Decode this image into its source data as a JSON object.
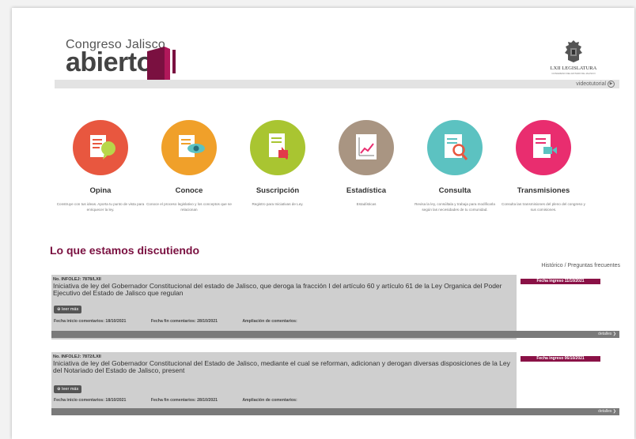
{
  "header": {
    "logo_top": "Congreso Jalisco",
    "logo_main": "abierto",
    "legislature_title": "LXII LEGISLATURA",
    "legislature_subtitle": "CONGRESO DEL ESTADO DE JALISCO",
    "video_link": "videotutorial"
  },
  "services": [
    {
      "title": "Opina",
      "desc": "Construye con tus ideas. Aporta tu punto de vista para enriquecer la ley.",
      "color": "#e8573f",
      "icon": "chat-bubble-icon"
    },
    {
      "title": "Conoce",
      "desc": "Conoce el proceso legislativo y los conceptos que se relacionan",
      "color": "#f0a02a",
      "icon": "eye-icon"
    },
    {
      "title": "Suscripción",
      "desc": "Registro para Iniciativas de Ley.",
      "color": "#a9c531",
      "icon": "cursor-click-icon"
    },
    {
      "title": "Estadística",
      "desc": "Estadísticas",
      "color": "#a99582",
      "icon": "chart-icon"
    },
    {
      "title": "Consulta",
      "desc": "Revisa la ley, consúltala y trabaja para modificarla según las necesidades de tu comunidad.",
      "color": "#5cc2c1",
      "icon": "magnifier-icon"
    },
    {
      "title": "Transmisiones",
      "desc": "Consulta las transmisiones del pleno del congreso y sus comisiones.",
      "color": "#e92d6f",
      "icon": "video-camera-icon"
    }
  ],
  "section": {
    "title": "Lo que estamos discutiendo",
    "history_link": "Histórico / Preguntas frecuentes"
  },
  "initiatives": [
    {
      "number": "No. INFOLEJ: 7878/LXII",
      "text": "Iniciativa de ley del Gobernador Constitucional del estado de Jalisco, que deroga la fracción I del artículo 60 y artículo 61 de la Ley Organica del Poder Ejecutivo del Estado de Jalisco que regulan",
      "read_more": "leer más",
      "start_label": "Fecha inicio comentarios: 18/10/2021",
      "end_label": "Fecha fin comentarios: 28/10/2021",
      "extension_label": "Ampliación de comentarios:",
      "badge": "Fecha ingreso 11/10/2021",
      "details": "detalles"
    },
    {
      "number": "No. INFOLEJ: 7872/LXII",
      "text": "Iniciativa de ley del Gobernador Constitucional del Estado de Jalisco, mediante el cual se reforman, adicionan y derogan diversas disposiciones de la Ley del Notariado del Estado de Jalisco, present",
      "read_more": "leer más",
      "start_label": "Fecha inicio comentarios: 18/10/2021",
      "end_label": "Fecha fin comentarios: 28/10/2021",
      "extension_label": "Ampliación de comentarios:",
      "badge": "Fecha ingreso 06/10/2021",
      "details": "detalles"
    }
  ]
}
